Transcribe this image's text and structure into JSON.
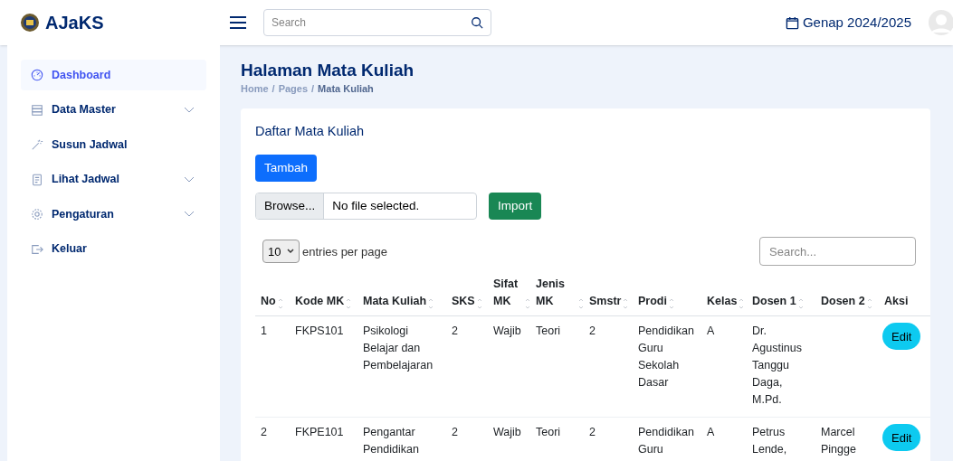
{
  "brand": "AJaKS",
  "search": {
    "placeholder": "Search"
  },
  "term": "Genap 2024/2025",
  "sidebar": {
    "items": [
      {
        "label": "Dashboard",
        "kind": "gauge",
        "selected": true,
        "expandable": false
      },
      {
        "label": "Data Master",
        "kind": "server",
        "selected": false,
        "expandable": true
      },
      {
        "label": "Susun Jadwal",
        "kind": "wand",
        "selected": false,
        "expandable": false
      },
      {
        "label": "Lihat Jadwal",
        "kind": "doc",
        "selected": false,
        "expandable": true
      },
      {
        "label": "Pengaturan",
        "kind": "gear",
        "selected": false,
        "expandable": true
      },
      {
        "label": "Keluar",
        "kind": "exit",
        "selected": false,
        "expandable": false
      }
    ]
  },
  "page": {
    "title": "Halaman Mata Kuliah",
    "breadcrumb": [
      "Home",
      "Pages",
      "Mata Kuliah"
    ],
    "breadcrumb_separator": "/"
  },
  "card": {
    "title": "Daftar Mata Kuliah",
    "add_button": "Tambah",
    "file": {
      "browse": "Browse...",
      "status": "No file selected."
    },
    "import_button": "Import",
    "page_size": "10",
    "page_size_label": "entries per page",
    "table_search": {
      "placeholder": "Search..."
    }
  },
  "table": {
    "columns": [
      "No",
      "Kode MK",
      "Mata Kuliah",
      "SKS",
      "Sifat MK",
      "Jenis MK",
      "Smstr",
      "Prodi",
      "Kelas",
      "Dosen 1",
      "Dosen 2",
      "Aksi"
    ],
    "rows": [
      {
        "cells": [
          [
            "1"
          ],
          [
            "FKPS101"
          ],
          [
            "Psikologi",
            "Belajar dan",
            "Pembelajaran"
          ],
          [
            "2"
          ],
          [
            "Wajib"
          ],
          [
            "Teori"
          ],
          [
            "2"
          ],
          [
            "Pendidikan",
            "Guru",
            "Sekolah",
            "Dasar"
          ],
          [
            "A"
          ],
          [
            "Dr.",
            "Agustinus",
            "Tanggu",
            "Daga,",
            "M.Pd."
          ],
          []
        ],
        "action": "Edit"
      },
      {
        "cells": [
          [
            "2"
          ],
          [
            "FKPE101"
          ],
          [
            "Pengantar",
            "Pendidikan"
          ],
          [
            "2"
          ],
          [
            "Wajib"
          ],
          [
            "Teori"
          ],
          [
            "2"
          ],
          [
            "Pendidikan",
            "Guru"
          ],
          [
            "A"
          ],
          [
            "Petrus",
            "Lende,"
          ],
          [
            "Marcel",
            "Pingge"
          ]
        ],
        "action": "Edit"
      }
    ]
  }
}
